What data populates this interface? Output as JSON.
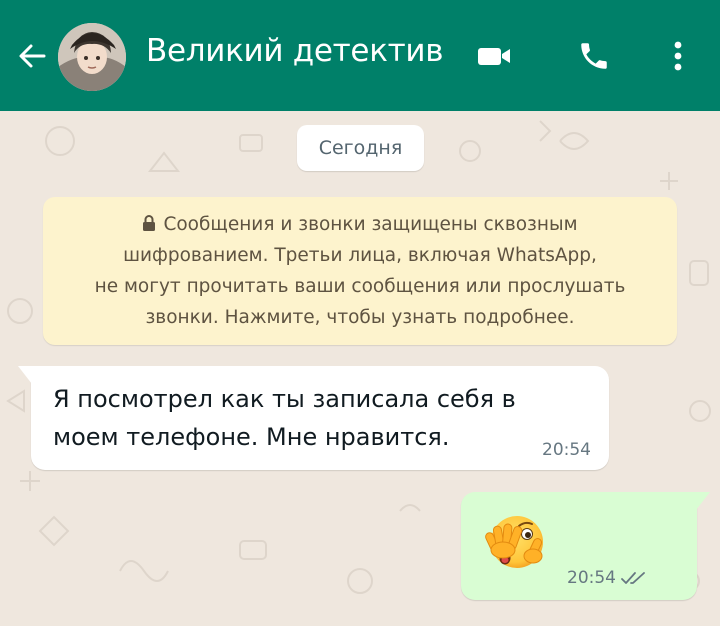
{
  "header": {
    "title": "Великий детектив",
    "back_icon": "arrow-left-icon",
    "video_icon": "video-call-icon",
    "call_icon": "phone-icon",
    "menu_icon": "more-vertical-icon",
    "color": "#008069"
  },
  "chat": {
    "date_chip": "Сегодня",
    "encryption_notice": {
      "lines": [
        "Сообщения и звонки защищены сквозным",
        "шифрованием. Третьи лица, включая WhatsApp,",
        "не могут прочитать ваши сообщения или прослушать",
        "звонки. Нажмите, чтобы узнать подробнее."
      ],
      "icon": "lock-icon"
    },
    "messages": [
      {
        "direction": "incoming",
        "text_lines": [
          "Я посмотрел как ты записала себя в",
          "моем телефоне. Мне нравится."
        ],
        "time": "20:54"
      },
      {
        "direction": "outgoing",
        "emoji": "face-with-peeking-eye",
        "time": "20:54",
        "status_icon": "double-check-icon"
      }
    ]
  },
  "colors": {
    "incoming_bubble": "#ffffff",
    "outgoing_bubble": "#d9fdd3",
    "notice_bg": "#fdf3cd",
    "chat_bg": "#efe7de"
  }
}
